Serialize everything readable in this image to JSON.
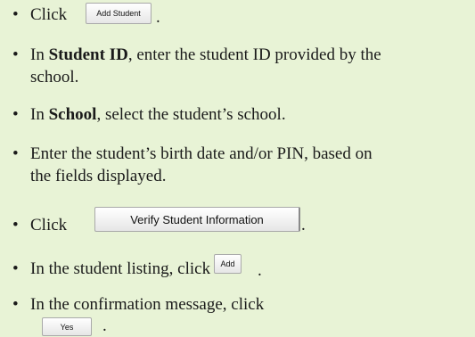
{
  "bullet": "•",
  "items": [
    {
      "text": "Click"
    },
    {
      "pre": "In ",
      "bold": "Student ID",
      "post": ", enter the student ID provided by the",
      "cont": "school."
    },
    {
      "pre": "In ",
      "bold": "School",
      "post": ", select the student’s school."
    },
    {
      "text": "Enter the student’s birth date and/or PIN, based on",
      "cont": "the fields displayed."
    },
    {
      "text": "Click"
    },
    {
      "text": "In the student listing, click"
    },
    {
      "text": "In the confirmation message, click"
    }
  ],
  "buttons": {
    "add_student": "Add Student",
    "verify_student_information": "Verify Student Information",
    "add": "Add",
    "yes": "Yes"
  },
  "period": "."
}
